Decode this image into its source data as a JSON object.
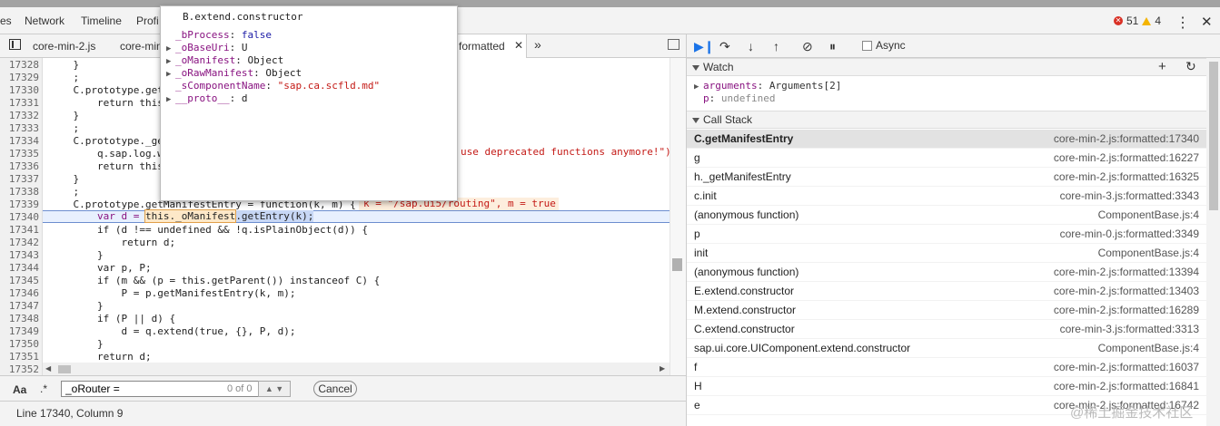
{
  "top_tabs": [
    "es",
    "Network",
    "Timeline",
    "Profi"
  ],
  "errors": {
    "error_count": "51",
    "warning_count": "4"
  },
  "source_tabs": [
    "core-min-2.js",
    "core-min",
    "formatted"
  ],
  "code_lines": [
    {
      "n": "17328",
      "t": "    }"
    },
    {
      "n": "17329",
      "t": "    ;"
    },
    {
      "n": "17330",
      "t": "    C.prototype.get"
    },
    {
      "n": "17331",
      "t": "        return this"
    },
    {
      "n": "17332",
      "t": "    }"
    },
    {
      "n": "17333",
      "t": "    ;"
    },
    {
      "n": "17334",
      "t": "    C.prototype._ge"
    },
    {
      "n": "17335",
      "t": "        q.sap.log.w"
    },
    {
      "n": "17336",
      "t": "        return this"
    },
    {
      "n": "17337",
      "t": "    }"
    },
    {
      "n": "17338",
      "t": "    ;"
    },
    {
      "n": "17339",
      "t": "    C.prototype.getManifestEntry = function(k, m) {"
    },
    {
      "n": "17340",
      "t": ""
    },
    {
      "n": "17341",
      "t": "        if (d !== undefined && !q.isPlainObject(d)) {"
    },
    {
      "n": "17342",
      "t": "            return d;"
    },
    {
      "n": "17343",
      "t": "        }"
    },
    {
      "n": "17344",
      "t": "        var p, P;"
    },
    {
      "n": "17345",
      "t": "        if (m && (p = this.getParent()) instanceof C) {"
    },
    {
      "n": "17346",
      "t": "            P = p.getManifestEntry(k, m);"
    },
    {
      "n": "17347",
      "t": "        }"
    },
    {
      "n": "17348",
      "t": "        if (P || d) {"
    },
    {
      "n": "17349",
      "t": "            d = q.extend(true, {}, P, d);"
    },
    {
      "n": "17350",
      "t": "        }"
    },
    {
      "n": "17351",
      "t": "        return d;"
    },
    {
      "n": "17352",
      "t": ""
    }
  ],
  "code_extra": {
    "line17335_tail": "use deprecated functions anymore!\")",
    "line17339_hint": "k = \"/sap.ui5/routing\", m = true",
    "line17340_a": "        var d = ",
    "line17340_b": "this._oManifest",
    "line17340_c": ".getEntry(k);"
  },
  "search": {
    "aa": "Aa",
    "regex": ".*",
    "value": "_oRouter =",
    "count": "0 of 0",
    "cancel": "Cancel"
  },
  "status": "Line 17340, Column 9",
  "debugger": {
    "async_label": "Async"
  },
  "watch": {
    "title": "Watch",
    "rows": [
      {
        "key": "arguments",
        "value": "Arguments[2]"
      },
      {
        "key": "p",
        "value": "undefined"
      }
    ]
  },
  "callstack": {
    "title": "Call Stack",
    "rows": [
      {
        "fn": "C.getManifestEntry",
        "loc": "core-min-2.js:formatted:17340",
        "selected": true
      },
      {
        "fn": "g",
        "loc": "core-min-2.js:formatted:16227"
      },
      {
        "fn": "h._getManifestEntry",
        "loc": "core-min-2.js:formatted:16325"
      },
      {
        "fn": "c.init",
        "loc": "core-min-3.js:formatted:3343"
      },
      {
        "fn": "(anonymous function)",
        "loc": "ComponentBase.js:4"
      },
      {
        "fn": "p",
        "loc": "core-min-0.js:formatted:3349"
      },
      {
        "fn": "init",
        "loc": "ComponentBase.js:4"
      },
      {
        "fn": "(anonymous function)",
        "loc": "core-min-2.js:formatted:13394"
      },
      {
        "fn": "E.extend.constructor",
        "loc": "core-min-2.js:formatted:13403"
      },
      {
        "fn": "M.extend.constructor",
        "loc": "core-min-2.js:formatted:16289"
      },
      {
        "fn": "C.extend.constructor",
        "loc": "core-min-3.js:formatted:3313"
      },
      {
        "fn": "sap.ui.core.UIComponent.extend.constructor",
        "loc": "ComponentBase.js:4"
      },
      {
        "fn": "f",
        "loc": "core-min-2.js:formatted:16037"
      },
      {
        "fn": "H",
        "loc": "core-min-2.js:formatted:16841"
      },
      {
        "fn": "e",
        "loc": "core-min-2.js:formatted:16742"
      }
    ]
  },
  "popover": {
    "title": "B.extend.constructor",
    "rows": [
      {
        "key": "_bProcess",
        "value": "false",
        "type": "bool",
        "expand": false
      },
      {
        "key": "_oBaseUri",
        "value": "U",
        "type": "obj",
        "expand": true
      },
      {
        "key": "_oManifest",
        "value": "Object",
        "type": "obj",
        "expand": true
      },
      {
        "key": "_oRawManifest",
        "value": "Object",
        "type": "obj",
        "expand": true
      },
      {
        "key": "_sComponentName",
        "value": "\"sap.ca.scfld.md\"",
        "type": "str",
        "expand": false
      },
      {
        "key": "__proto__",
        "value": "d",
        "type": "obj",
        "expand": true
      }
    ]
  },
  "watermark": "@稀土掘金技术社区"
}
